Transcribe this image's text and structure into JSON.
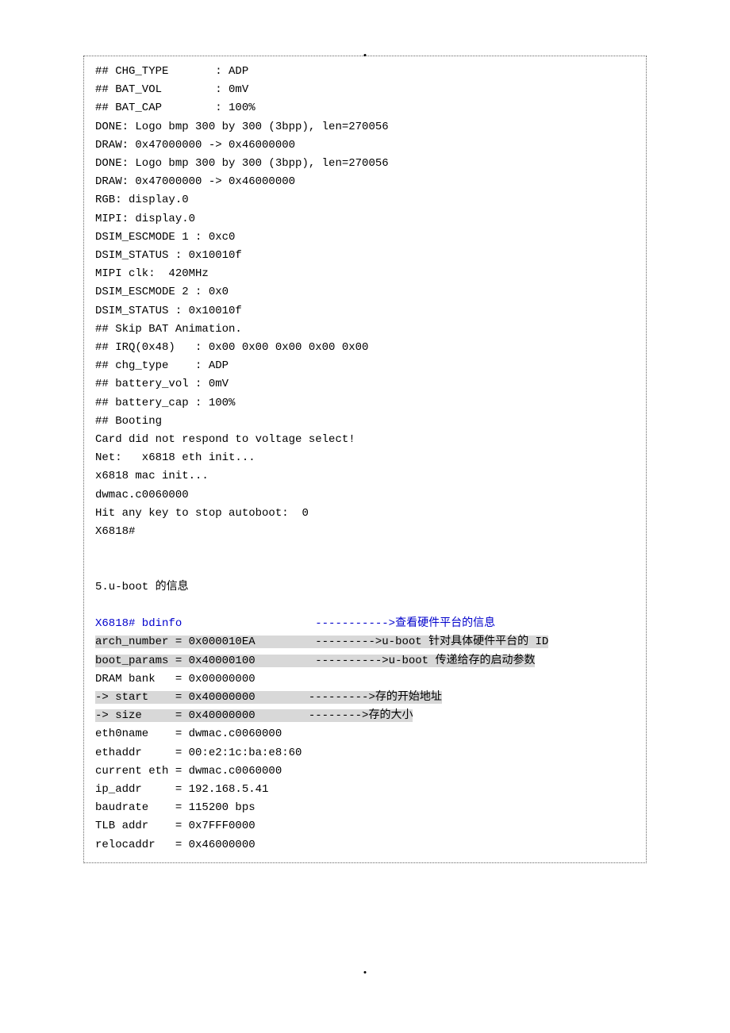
{
  "terminal": [
    "## CHG_TYPE       : ADP",
    "## BAT_VOL        : 0mV",
    "## BAT_CAP        : 100%",
    "DONE: Logo bmp 300 by 300 (3bpp), len=270056",
    "DRAW: 0x47000000 -> 0x46000000",
    "DONE: Logo bmp 300 by 300 (3bpp), len=270056",
    "DRAW: 0x47000000 -> 0x46000000",
    "RGB: display.0",
    "MIPI: display.0",
    "DSIM_ESCMODE 1 : 0xc0",
    "DSIM_STATUS : 0x10010f",
    "MIPI clk:  420MHz",
    "DSIM_ESCMODE 2 : 0x0",
    "DSIM_STATUS : 0x10010f",
    "## Skip BAT Animation.",
    "## IRQ(0x48)   : 0x00 0x00 0x00 0x00 0x00",
    "## chg_type    : ADP",
    "## battery_vol : 0mV",
    "## battery_cap : 100%",
    "## Booting",
    "Card did not respond to voltage select!",
    "Net:   x6818 eth init...",
    "x6818 mac init...",
    "dwmac.c0060000",
    "Hit any key to stop autoboot:  0",
    "X6818#"
  ],
  "section_title": "5.u-boot 的信息",
  "cmd": {
    "prefix": "X6818# bdinfo                    ",
    "suffix": "----------->查看硬件平台的信息"
  },
  "bdinfo_hi1": [
    {
      "l": "arch_number = 0x000010EA         ",
      "r": "--------->u-boot 针对具体硬件平台的 ID"
    },
    {
      "l": "boot_params = 0x40000100         ",
      "r": "---------->u-boot 传递给存的启动参数"
    }
  ],
  "bdinfo_plain1": "DRAM bank   = 0x00000000",
  "bdinfo_hi2": [
    {
      "l": "-> start    = 0x40000000        ",
      "r": "--------->存的开始地址"
    },
    {
      "l": "-> size     = 0x40000000        ",
      "r": "-------->存的大小"
    }
  ],
  "bdinfo_tail": [
    "eth0name    = dwmac.c0060000",
    "ethaddr     = 00:e2:1c:ba:e8:60",
    "current eth = dwmac.c0060000",
    "ip_addr     = 192.168.5.41",
    "baudrate    = 115200 bps",
    "TLB addr    = 0x7FFF0000",
    "relocaddr   = 0x46000000"
  ]
}
